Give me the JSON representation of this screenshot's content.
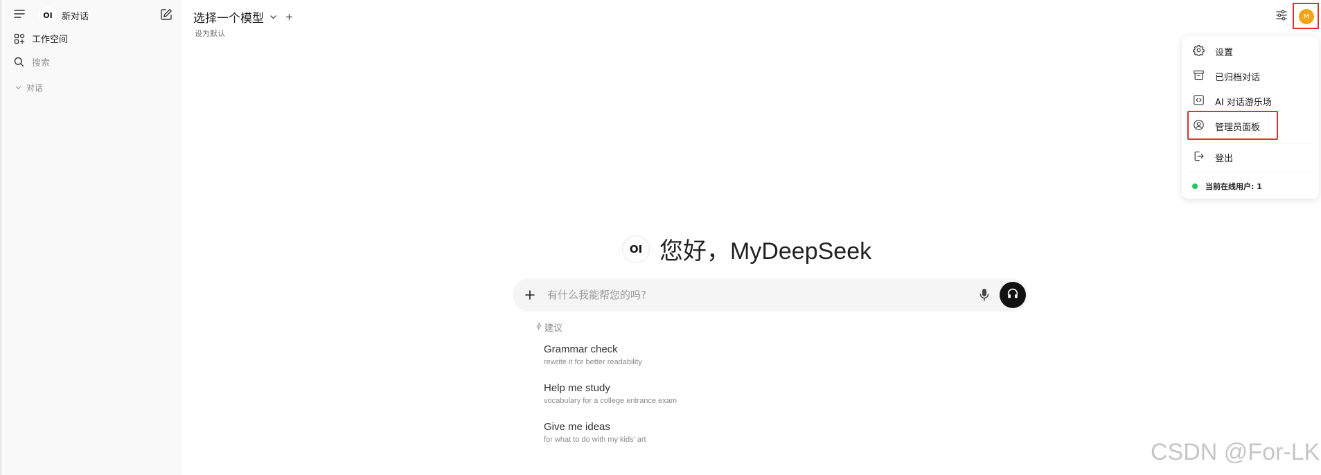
{
  "sidebar": {
    "logo_text": "OI",
    "new_chat_label": "新对话",
    "workspace_label": "工作空间",
    "search_placeholder": "搜索",
    "chats_section_label": "对话"
  },
  "header": {
    "model_selector_label": "选择一个模型",
    "set_default_label": "设为默认",
    "avatar_initial": "M"
  },
  "user_menu": {
    "items": [
      {
        "label": "设置",
        "icon": "gear-icon"
      },
      {
        "label": "已归档对话",
        "icon": "archive-icon"
      },
      {
        "label": "AI 对话游乐场",
        "icon": "code-icon"
      },
      {
        "label": "管理员面板",
        "icon": "user-circle-icon"
      },
      {
        "label": "登出",
        "icon": "logout-icon"
      }
    ],
    "online_users_label": "当前在线用户: 1",
    "online_color": "#22c55e"
  },
  "main": {
    "logo_text": "OI",
    "greeting": "您好，MyDeepSeek",
    "input_placeholder": "有什么我能帮您的吗?",
    "suggestions_header": "建议",
    "suggestions": [
      {
        "title": "Grammar check",
        "subtitle": "rewrite it for better readability"
      },
      {
        "title": "Help me study",
        "subtitle": "vocabulary for a college entrance exam"
      },
      {
        "title": "Give me ideas",
        "subtitle": "for what to do with my kids' art"
      }
    ]
  },
  "watermark": "CSDN @For-LK",
  "colors": {
    "sidebar_bg": "#f9f9f9",
    "avatar_bg": "#f5a316",
    "highlight_border": "#e03030"
  }
}
